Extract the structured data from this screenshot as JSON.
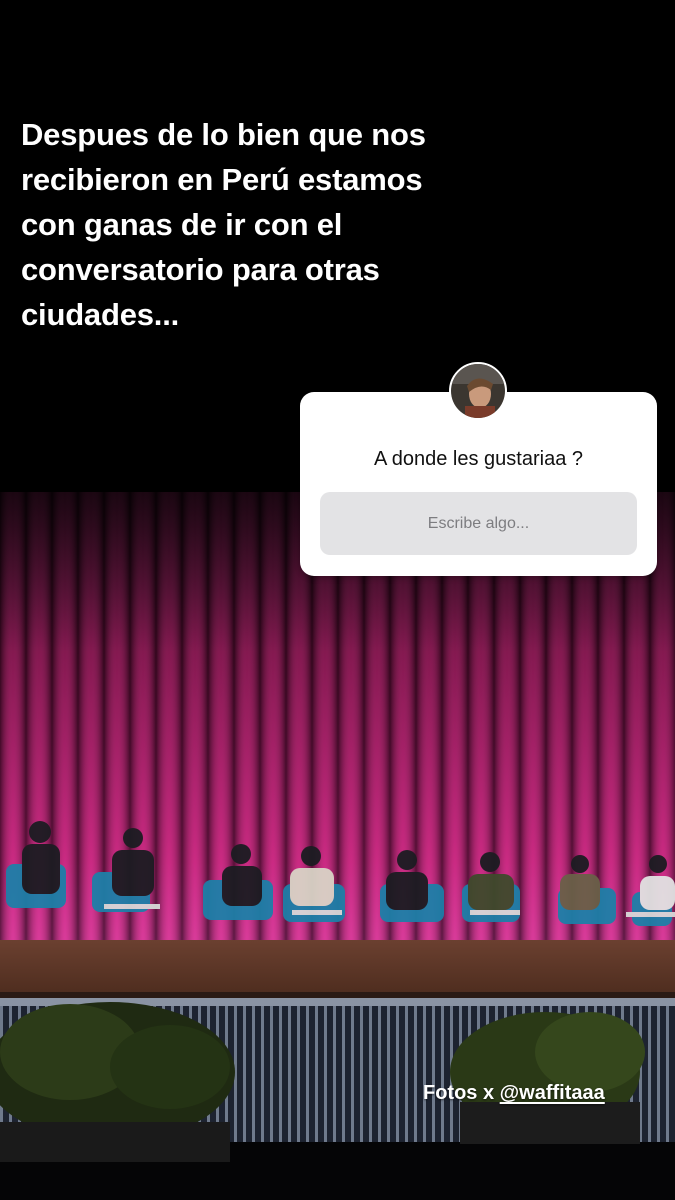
{
  "story": {
    "caption": "Despues de lo bien que nos\nrecibieron en Perú estamos\ncon ganas de ir con el\nconversatorio para otras\nciudades...",
    "question_sticker": {
      "question": "A donde les gustariaa ?",
      "input_placeholder": "Escribe algo..."
    },
    "credit": {
      "prefix": "Fotos x ",
      "mention": "@waffitaaa"
    }
  },
  "colors": {
    "background": "#000000",
    "curtain": "#b0195f",
    "stage": "#5a3423",
    "sticker": "#ffffff",
    "input": "#e3e3e5"
  }
}
